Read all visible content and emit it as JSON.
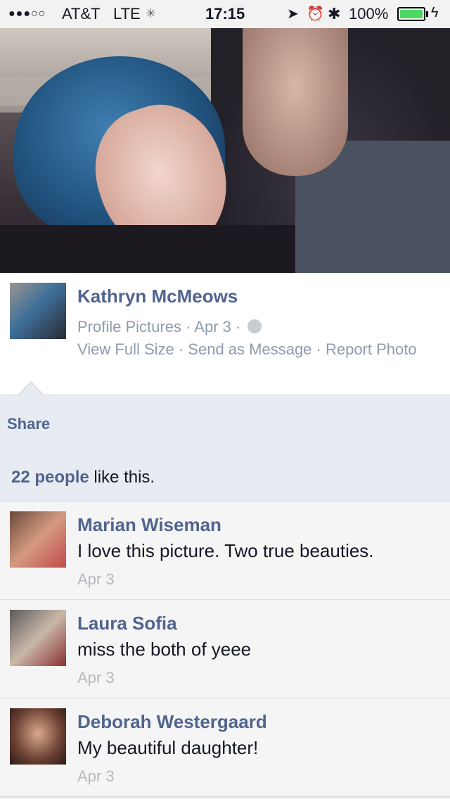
{
  "status_bar": {
    "signal": "●●●○○",
    "carrier": "AT&T",
    "network": "LTE",
    "time": "17:15",
    "battery_percent": "100%",
    "battery_level": 1.0
  },
  "post": {
    "author": "Kathryn McMeows",
    "album": "Profile Pictures",
    "separator": " · ",
    "date": "Apr 3",
    "actions_text": "View Full Size · Send as Message · Report Photo"
  },
  "share": {
    "label": "Share"
  },
  "likes": {
    "count_text": "22 people",
    "suffix": " like this."
  },
  "comments": [
    {
      "name": "Marian Wiseman",
      "text": "I love this picture. Two true beauties.",
      "date": "Apr 3"
    },
    {
      "name": "Laura Sofia",
      "text": "miss the both of yeee",
      "date": "Apr 3"
    },
    {
      "name": "Deborah Westergaard",
      "text": "My beautiful daughter!",
      "date": "Apr 3"
    }
  ],
  "colors": {
    "link_blue": "#50648f",
    "meta_gray": "#8f9aae",
    "panel_bg": "#e9ebf2",
    "battery_green": "#4cd964"
  }
}
